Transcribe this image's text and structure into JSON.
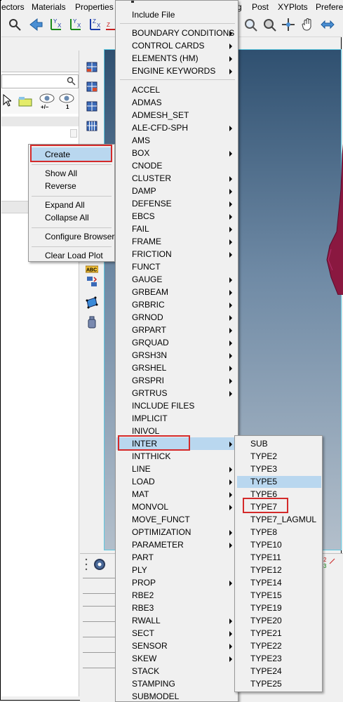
{
  "menubar": {
    "items": [
      "ectors",
      "Materials",
      "Properties",
      "g",
      "Post",
      "XYPlots",
      "Prefere"
    ]
  },
  "toolbar": {
    "icons": [
      "zoom-icon",
      "back-arrow-icon",
      "y-x-axis-icon",
      "y-x-axis-icon",
      "z-x-axis-icon",
      "x-axis-icon",
      "zoom-in-icon",
      "zoom-fit-icon",
      "rotate-center-icon",
      "pan-hand-icon",
      "double-arrow-icon"
    ]
  },
  "browser": {
    "tool_labels": [
      "+/–",
      "1"
    ]
  },
  "context_menu": {
    "groups": [
      [
        "Create"
      ],
      [
        "Show All",
        "Reverse"
      ],
      [
        "Expand All",
        "Collapse All"
      ],
      [
        "Configure Browser"
      ],
      [
        "Clear Load Plot"
      ]
    ]
  },
  "main_menu": {
    "include_file": "Include File",
    "section_1": [
      {
        "label": "BOUNDARY CONDITIONS",
        "sub": true
      },
      {
        "label": "CONTROL CARDS",
        "sub": true
      },
      {
        "label": "ELEMENTS (HM)",
        "sub": true
      },
      {
        "label": "ENGINE KEYWORDS",
        "sub": true
      }
    ],
    "section_2": [
      {
        "label": "ACCEL",
        "sub": false
      },
      {
        "label": "ADMAS",
        "sub": false
      },
      {
        "label": "ADMESH_SET",
        "sub": false
      },
      {
        "label": "ALE-CFD-SPH",
        "sub": true
      },
      {
        "label": "AMS",
        "sub": false
      },
      {
        "label": "BOX",
        "sub": true
      },
      {
        "label": "CNODE",
        "sub": false
      },
      {
        "label": "CLUSTER",
        "sub": true
      },
      {
        "label": "DAMP",
        "sub": true
      },
      {
        "label": "DEFENSE",
        "sub": true
      },
      {
        "label": "EBCS",
        "sub": true
      },
      {
        "label": "FAIL",
        "sub": true
      },
      {
        "label": "FRAME",
        "sub": true
      },
      {
        "label": "FRICTION",
        "sub": true
      },
      {
        "label": "FUNCT",
        "sub": false
      },
      {
        "label": "GAUGE",
        "sub": true
      },
      {
        "label": "GRBEAM",
        "sub": true
      },
      {
        "label": "GRBRIC",
        "sub": true
      },
      {
        "label": "GRNOD",
        "sub": true
      },
      {
        "label": "GRPART",
        "sub": true
      },
      {
        "label": "GRQUAD",
        "sub": true
      },
      {
        "label": "GRSH3N",
        "sub": true
      },
      {
        "label": "GRSHEL",
        "sub": true
      },
      {
        "label": "GRSPRI",
        "sub": true
      },
      {
        "label": "GRTRUS",
        "sub": true
      },
      {
        "label": "INCLUDE FILES",
        "sub": false
      },
      {
        "label": "IMPLICIT",
        "sub": false
      },
      {
        "label": "INIVOL",
        "sub": false
      },
      {
        "label": "INTER",
        "sub": true
      },
      {
        "label": "INTTHICK",
        "sub": false
      },
      {
        "label": "LINE",
        "sub": true
      },
      {
        "label": "LOAD",
        "sub": true
      },
      {
        "label": "MAT",
        "sub": true
      },
      {
        "label": "MONVOL",
        "sub": true
      },
      {
        "label": "MOVE_FUNCT",
        "sub": false
      },
      {
        "label": "OPTIMIZATION",
        "sub": true
      },
      {
        "label": "PARAMETER",
        "sub": true
      },
      {
        "label": "PART",
        "sub": false
      },
      {
        "label": "PLY",
        "sub": false
      },
      {
        "label": "PROP",
        "sub": true
      },
      {
        "label": "RBE2",
        "sub": false
      },
      {
        "label": "RBE3",
        "sub": false
      },
      {
        "label": "RWALL",
        "sub": true
      },
      {
        "label": "SECT",
        "sub": true
      },
      {
        "label": "SENSOR",
        "sub": true
      },
      {
        "label": "SKEW",
        "sub": true
      },
      {
        "label": "STACK",
        "sub": false
      },
      {
        "label": "STAMPING",
        "sub": false
      },
      {
        "label": "SUBMODEL",
        "sub": false
      }
    ]
  },
  "submenu": {
    "items": [
      "SUB",
      "TYPE2",
      "TYPE3",
      "TYPE5",
      "TYPE6",
      "TYPE7",
      "TYPE7_LAGMUL",
      "TYPE8",
      "TYPE10",
      "TYPE11",
      "TYPE12",
      "TYPE14",
      "TYPE15",
      "TYPE19",
      "TYPE20",
      "TYPE21",
      "TYPE22",
      "TYPE23",
      "TYPE24",
      "TYPE25"
    ],
    "highlighted": "TYPE5"
  },
  "viewport": {
    "corner_label": "2\n3"
  },
  "colors": {
    "highlight": "#b9d7ef",
    "callout": "#d42a2a",
    "viewport_top": "#2f5070",
    "viewport_bottom": "#b3bfcb",
    "viewport_border": "#5ec8e0"
  }
}
